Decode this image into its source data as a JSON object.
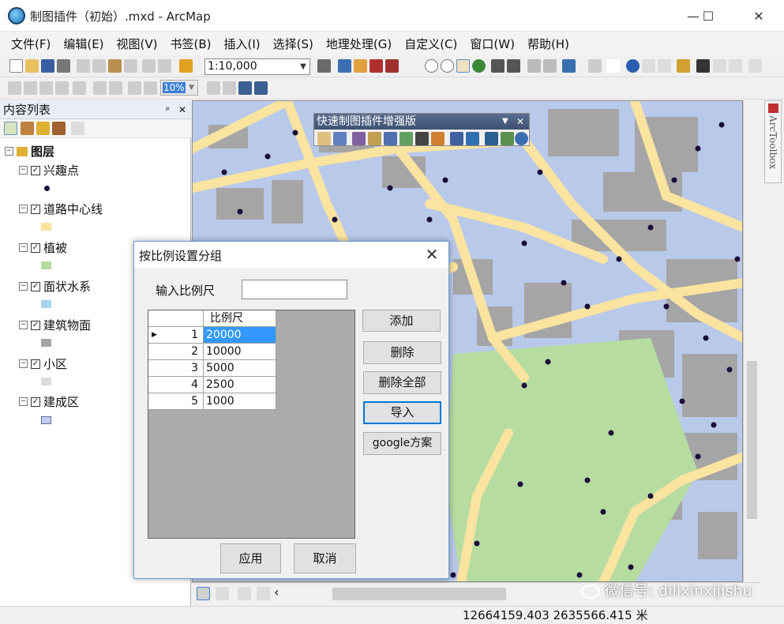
{
  "window": {
    "title": "制图插件（初始）.mxd - ArcMap",
    "minimize": "—",
    "maximize": "☐",
    "close": "✕"
  },
  "menu": [
    "文件(F)",
    "编辑(E)",
    "视图(V)",
    "书签(B)",
    "插入(I)",
    "选择(S)",
    "地理处理(G)",
    "自定义(C)",
    "窗口(W)",
    "帮助(H)"
  ],
  "toolbar": {
    "scale_value": "1:10,000",
    "zoom_value": "10%"
  },
  "toc": {
    "title": "内容列表",
    "pin": "ᵖ",
    "close": "✕",
    "root": "图层",
    "layers": [
      {
        "name": "兴趣点",
        "symbol": "point",
        "color": "#1a0d3a"
      },
      {
        "name": "道路中心线",
        "symbol": "fill",
        "color": "#fbe3a0"
      },
      {
        "name": "植被",
        "symbol": "fill",
        "color": "#b6dca0"
      },
      {
        "name": "面状水系",
        "symbol": "fill",
        "color": "#a6d4ef"
      },
      {
        "name": "建筑物面",
        "symbol": "fill",
        "color": "#a5a5a5"
      },
      {
        "name": "小区",
        "symbol": "fill",
        "color": "#dcdcdc"
      },
      {
        "name": "建成区",
        "symbol": "fill",
        "color": "#c4cbec"
      }
    ]
  },
  "quick_panel": {
    "title": "快速制图插件增强版"
  },
  "arctoolbox": "ArcToolbox",
  "dialog": {
    "title": "按比例设置分组",
    "input_label": "输入比例尺",
    "input_value": "",
    "column_header": "比例尺",
    "rows": [
      {
        "num": "1",
        "scale": "20000"
      },
      {
        "num": "2",
        "scale": "10000"
      },
      {
        "num": "3",
        "scale": "5000"
      },
      {
        "num": "4",
        "scale": "2500"
      },
      {
        "num": "5",
        "scale": "1000"
      }
    ],
    "buttons": {
      "add": "添加",
      "delete": "删除",
      "delete_all": "删除全部",
      "import": "导入",
      "google": "google方案",
      "apply": "应用",
      "cancel": "取消"
    }
  },
  "status": {
    "coords": "12664159.403  2635566.415 米"
  },
  "watermark": "微信号: dilixinxijishu",
  "colors": {
    "map_bg": "#b8c9ea",
    "road": "#fbe3a0",
    "building": "#a5a5a5",
    "vegetation": "#b6dca0",
    "poi": "#1a0d3a",
    "dialog_border": "#6a9bd6"
  }
}
